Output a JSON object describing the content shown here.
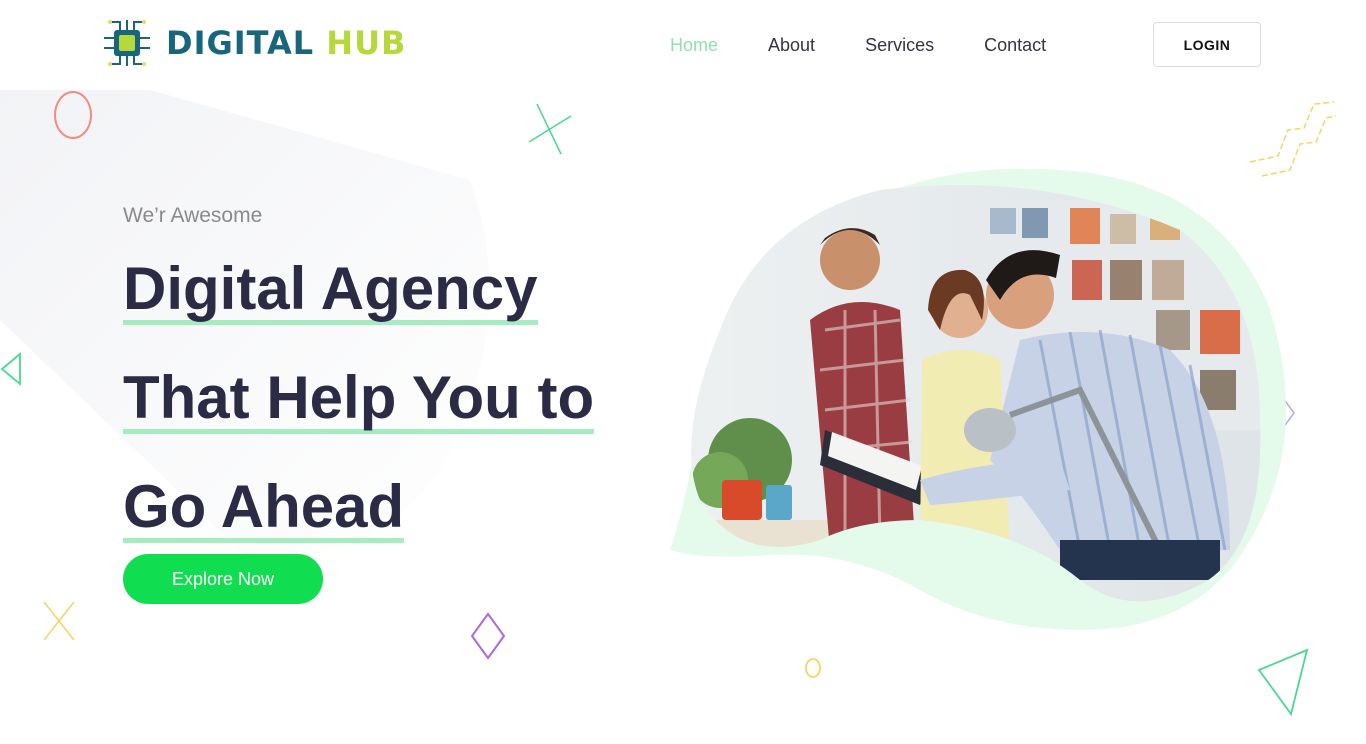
{
  "brand": {
    "name_part1": "DIGITAL",
    "name_part2": "HUB",
    "icon": "chip-icon"
  },
  "nav": {
    "items": [
      {
        "label": "Home",
        "active": true
      },
      {
        "label": "About",
        "active": false
      },
      {
        "label": "Services",
        "active": false
      },
      {
        "label": "Contact",
        "active": false
      }
    ],
    "login_label": "LOGIN"
  },
  "hero": {
    "eyebrow": "We’r Awesome",
    "headline_lines": [
      "Digital Agency",
      "That Help You to",
      "Go Ahead"
    ],
    "cta_label": "Explore Now",
    "image": "team-meeting-photo"
  },
  "colors": {
    "brand_blue": "#17667c",
    "brand_lime": "#b5d83b",
    "nav_active": "#8fe0ae",
    "cta_green": "#10dd4f",
    "headline": "#2b2b45",
    "underline": "#a5ecc1",
    "blob_mint": "#e4fbec"
  }
}
